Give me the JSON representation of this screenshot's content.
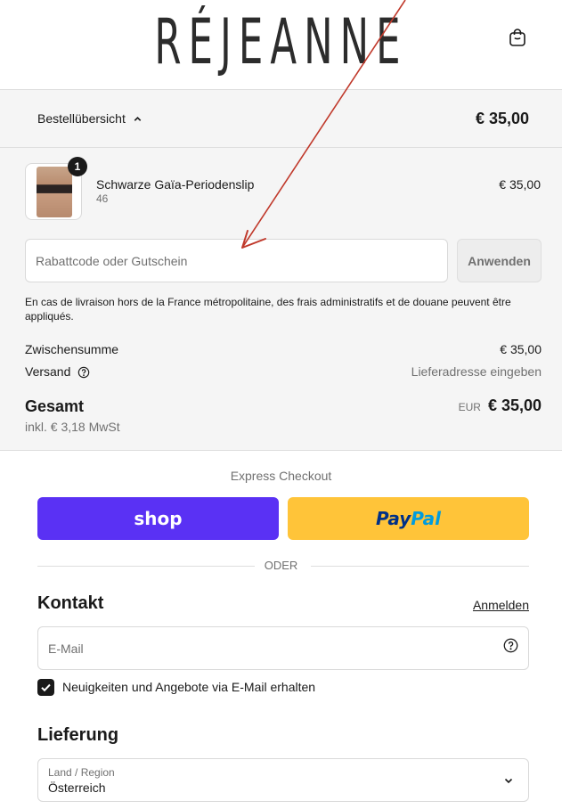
{
  "header": {
    "logo": "RÉJEANNE",
    "cart_icon": "shopping-bag-icon"
  },
  "summary_bar": {
    "toggle_label": "Bestellübersicht",
    "toggle_icon": "chevron-up-icon",
    "total": "€ 35,00"
  },
  "order": {
    "item": {
      "quantity": "1",
      "name": "Schwarze Gaïa-Periodenslip",
      "variant": "46",
      "price": "€ 35,00"
    },
    "discount": {
      "placeholder": "Rabattcode oder Gutschein",
      "apply_label": "Anwenden"
    },
    "notice": "En cas de livraison hors de la France métropolitaine, des frais administratifs et de douane peuvent être appliqués.",
    "subtotal_label": "Zwischensumme",
    "subtotal_value": "€ 35,00",
    "shipping_label": "Versand",
    "shipping_value": "Lieferadresse eingeben",
    "total_label": "Gesamt",
    "total_currency": "EUR",
    "total_value": "€ 35,00",
    "tax_line": "inkl. € 3,18 MwSt"
  },
  "express": {
    "title": "Express Checkout",
    "shop_label": "shop",
    "paypal_pay": "Pay",
    "paypal_pal": "Pal",
    "divider_label": "ODER"
  },
  "contact": {
    "title": "Kontakt",
    "signin_label": "Anmelden",
    "email_placeholder": "E-Mail",
    "newsletter_label": "Neuigkeiten und Angebote via E-Mail erhalten",
    "newsletter_checked": true
  },
  "delivery": {
    "title": "Lieferung",
    "country_label": "Land / Region",
    "country_value": "Österreich"
  },
  "colors": {
    "shop_pay": "#5a31f4",
    "paypal": "#ffc439",
    "annotation_arrow": "#c0392b"
  }
}
